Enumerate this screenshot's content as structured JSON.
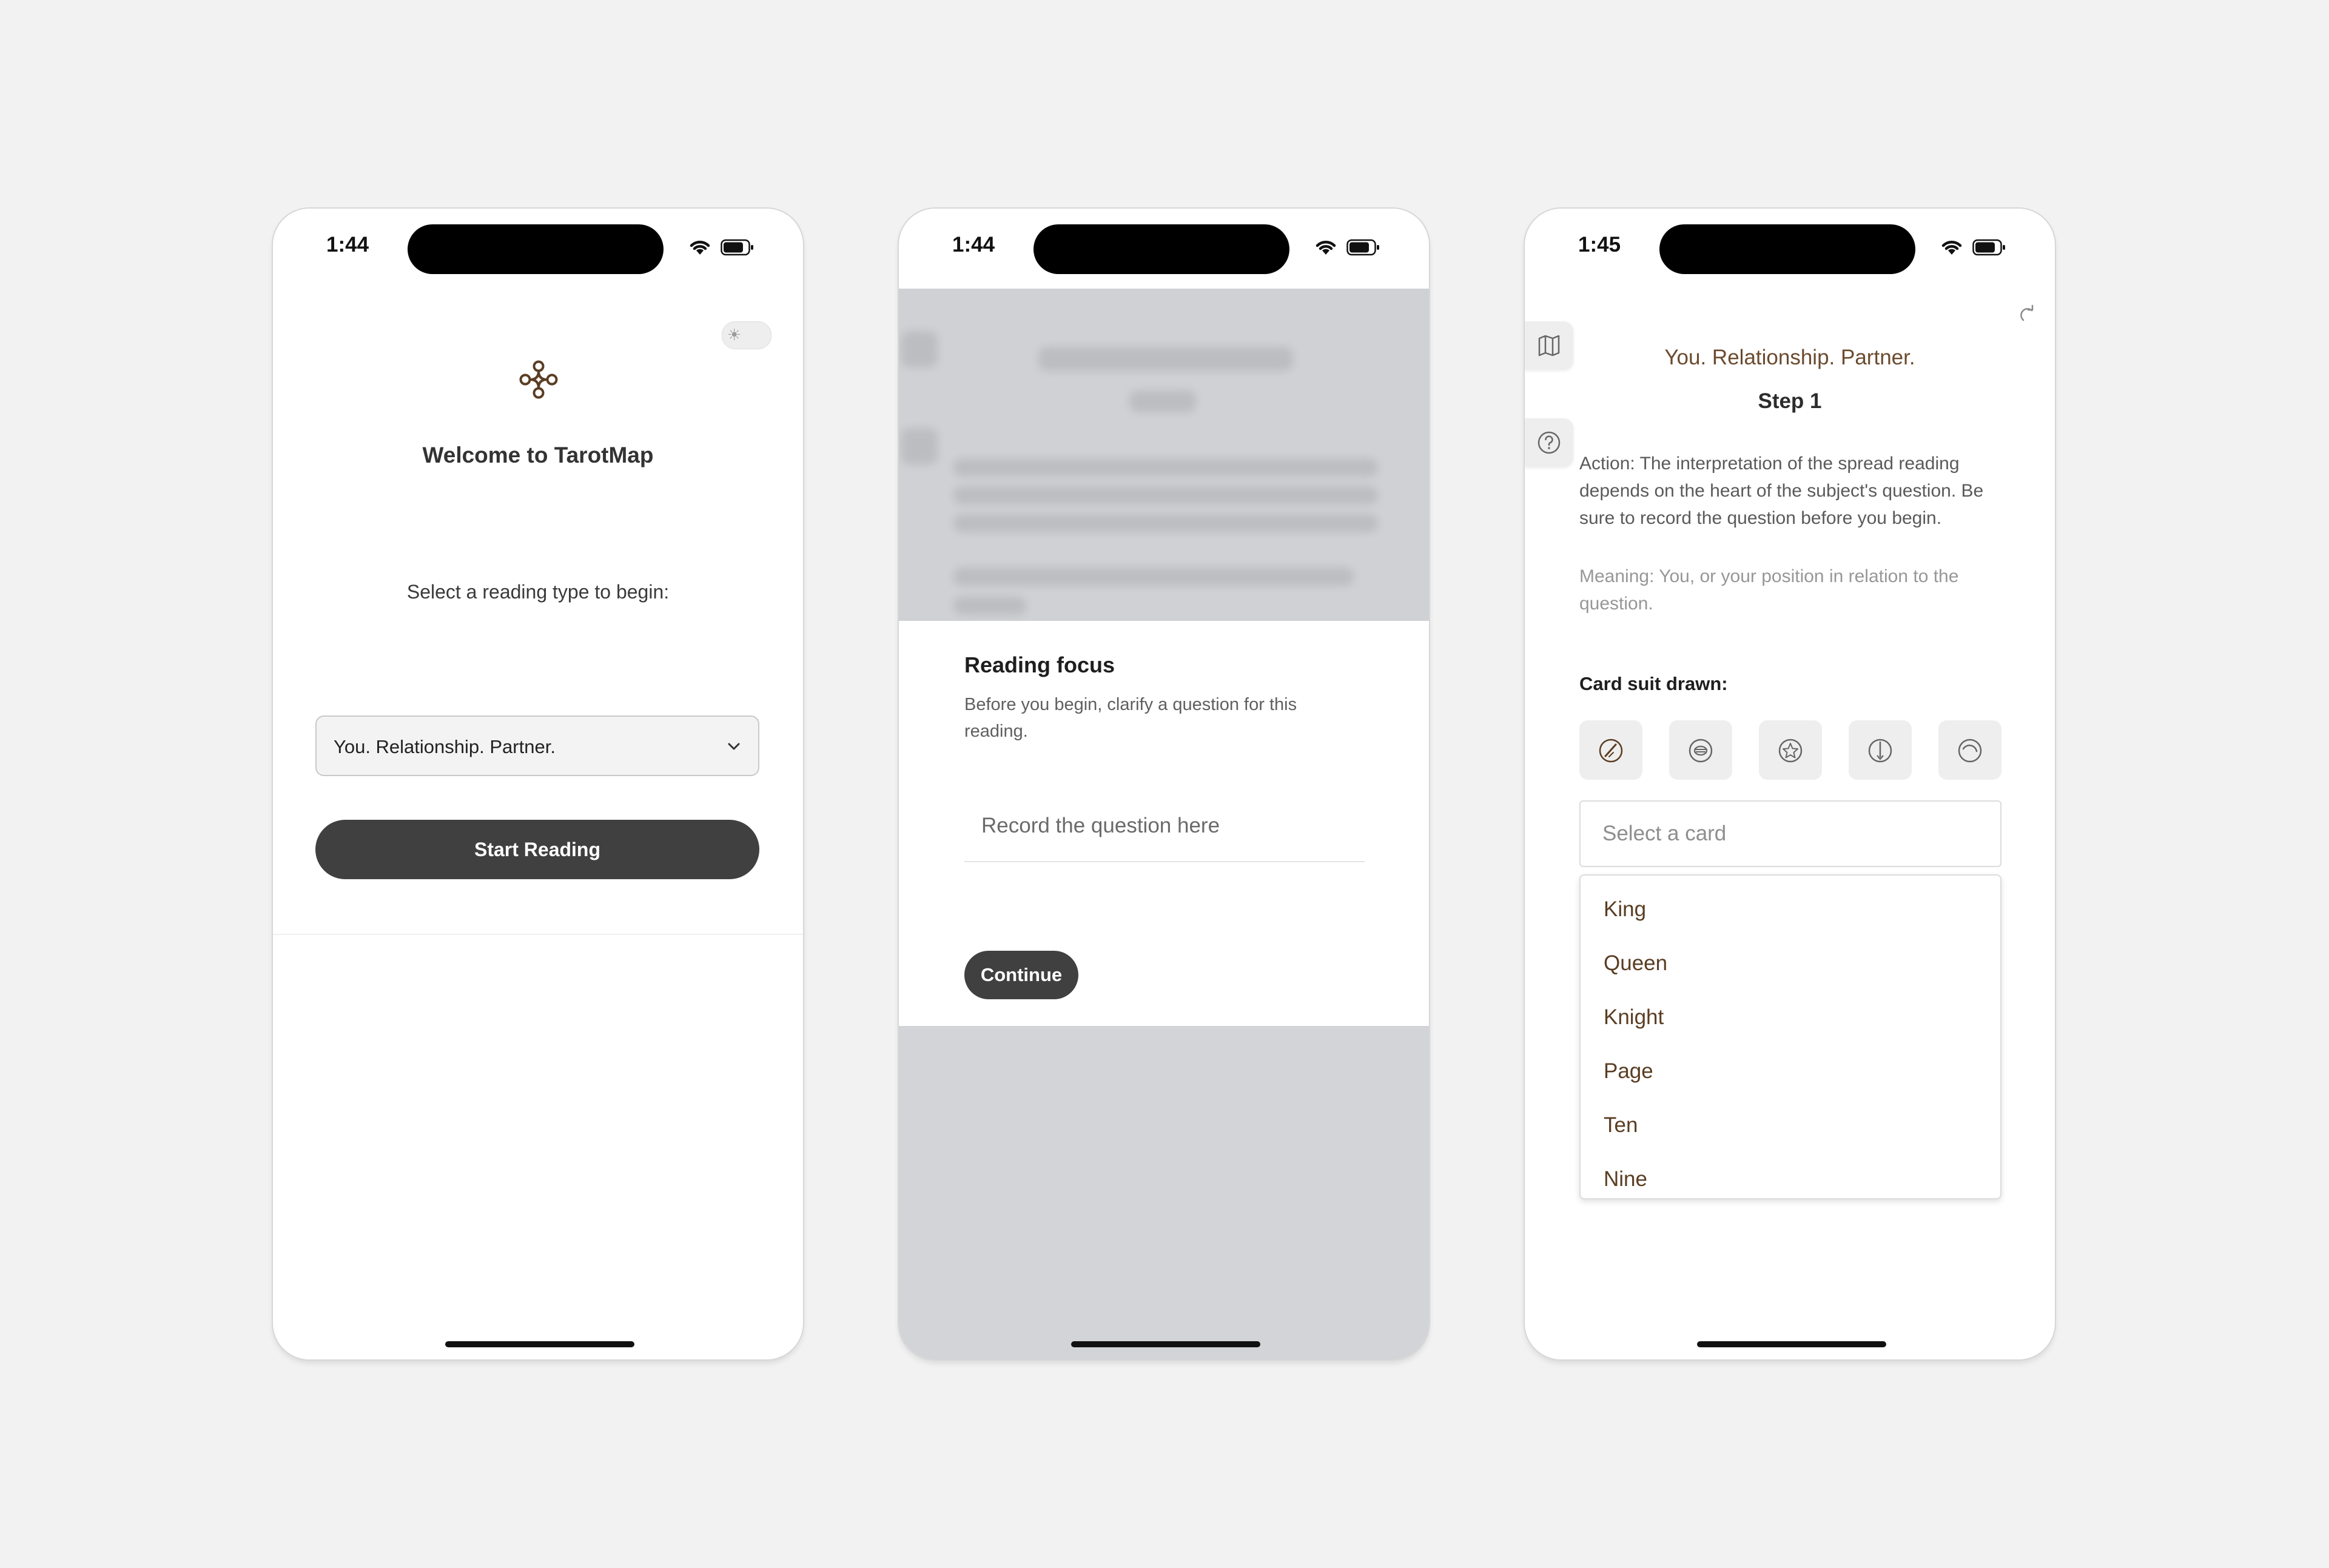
{
  "screens": [
    {
      "status_time": "1:44",
      "welcome_title": "Welcome to TarotMap",
      "select_prompt": "Select a reading type to begin:",
      "reading_type_value": "You. Relationship. Partner.",
      "start_button": "Start Reading"
    },
    {
      "status_time": "1:44",
      "focus_title": "Reading focus",
      "focus_description": "Before you begin, clarify a question for this reading.",
      "question_placeholder": "Record the question here",
      "continue_button": "Continue"
    },
    {
      "status_time": "1:45",
      "reading_title": "You. Relationship. Partner.",
      "step": "Step 1",
      "action": "Action: The interpretation of the spread reading depends on the heart of the subject's question. Be sure to record the question before you begin.",
      "meaning": "Meaning: You, or your position in relation to the question.",
      "suit_label": "Card suit drawn:",
      "suits": [
        {
          "icon": "wand-icon",
          "selected": true
        },
        {
          "icon": "cup-icon",
          "selected": false
        },
        {
          "icon": "pentacle-icon",
          "selected": false
        },
        {
          "icon": "sword-icon",
          "selected": false
        },
        {
          "icon": "major-arcana-icon",
          "selected": false
        }
      ],
      "card_placeholder": "Select a card",
      "card_options": [
        "King",
        "Queen",
        "Knight",
        "Page",
        "Ten",
        "Nine"
      ]
    }
  ],
  "colors": {
    "accent_brown": "#6b4a2e",
    "button_dark": "#404040",
    "background": "#f2f2f2"
  }
}
